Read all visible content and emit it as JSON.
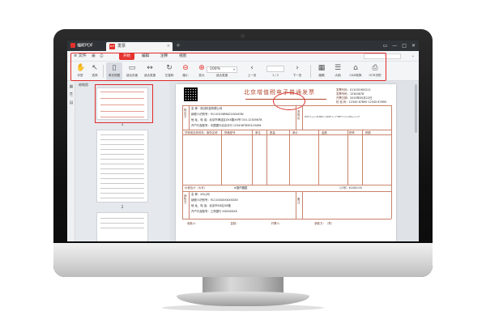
{
  "app": {
    "name": "福昕PDF",
    "brand_color": "#e5322d"
  },
  "tab": {
    "title": "发票",
    "close": "×",
    "new_tab": "+"
  },
  "window_controls": [
    "▭",
    "—",
    "□",
    "✕"
  ],
  "menu": {
    "file": "文件",
    "tabs": [
      "开始",
      "编辑",
      "注释",
      "视图"
    ],
    "active_tab": 0,
    "right": "⌄"
  },
  "toolbar": {
    "tools": [
      {
        "name": "hand-tool",
        "icon": "✋",
        "label": "手型"
      },
      {
        "name": "select-tool",
        "icon": "↖",
        "label": "选择"
      },
      {
        "name": "single-page",
        "icon": "▯",
        "label": "单页视图"
      },
      {
        "name": "fit-page",
        "icon": "▭",
        "label": "适合页面"
      },
      {
        "name": "fit-width",
        "icon": "↔",
        "label": "适合宽度"
      },
      {
        "name": "rotate",
        "icon": "↻",
        "label": "左旋转"
      },
      {
        "name": "zoom-out",
        "icon": "⊖",
        "label": "缩小"
      },
      {
        "name": "zoom-in",
        "icon": "⊕",
        "label": "放大"
      },
      {
        "name": "prev-page",
        "icon": "‹",
        "label": "上一页"
      },
      {
        "name": "next-page",
        "icon": "›",
        "label": "下一页"
      },
      {
        "name": "thumbnail",
        "icon": "▦",
        "label": "缩略"
      },
      {
        "name": "outline",
        "icon": "☰",
        "label": "大纲"
      },
      {
        "name": "cad-convert",
        "icon": "⌂",
        "label": "CAD转换"
      },
      {
        "name": "ocr",
        "icon": "⎙",
        "label": "OCR识别"
      }
    ],
    "zoom": "100%",
    "zoom_label": "适合宽度",
    "page_display": "1 / 2"
  },
  "sidebar": {
    "title": "缩略图",
    "pages": [
      "1",
      "2"
    ]
  },
  "document": {
    "invoice_title": "北京增值税电子普通发票",
    "meta": [
      {
        "label": "发票代码：",
        "value": "011001900211"
      },
      {
        "label": "发票号码：",
        "value": "12345678"
      },
      {
        "label": "开票日期：",
        "value": "2019年05月22日"
      },
      {
        "label": "校 验 码：",
        "value": "12345 67890 12345 67890"
      }
    ],
    "buyer": {
      "label": "购买方",
      "name": "名      称：测试科技有限公司",
      "tax_id": "纳税人识别号：91110108MA01XXXX3N",
      "address": "地 址、电 话：北京市海淀区XXX路XX号 010-12345678",
      "bank": "开户行及账号：中国银行北京分行 1234567890123456"
    },
    "password_label": "密码区",
    "password_value": "03*/>+<-6-89<>9/2*+-<*04*>>/<01+<>7",
    "goods_header": "货物或应税劳务、服务名称",
    "goods_cols": [
      "规格型号",
      "单位",
      "数量",
      "单价",
      "金额",
      "税率",
      "税额"
    ],
    "total_label": "价税合计（大写）",
    "total_words": "⊗壹仟圆整",
    "total_small": "（小写）¥1000.00",
    "seller": {
      "label": "销售方",
      "name": "名      称：XX公司",
      "tax_id": "纳税人识别号：91110XXXXXXXXXX",
      "address": "地 址、电 话：北京市XX区XX路",
      "bank": "开户行及账号：工商银行 XXXXXXXX"
    },
    "remark_label": "备注",
    "bottom": [
      "收款人：",
      "复核：",
      "开票人：",
      "销售方：（章）"
    ]
  }
}
